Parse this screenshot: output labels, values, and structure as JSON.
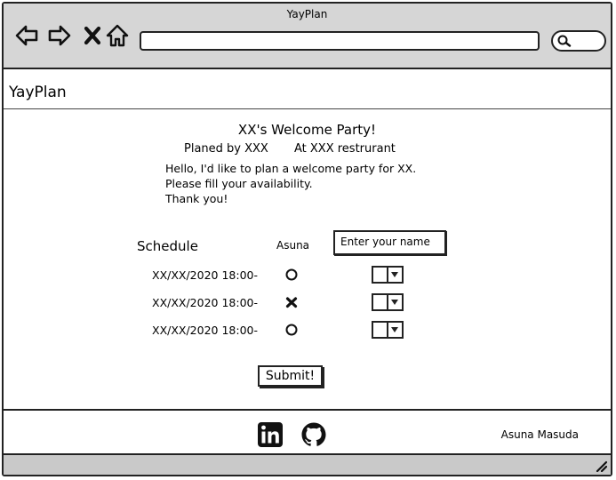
{
  "browser": {
    "title": "YayPlan",
    "nav_icons": [
      "back-arrow-icon",
      "forward-arrow-icon",
      "close-icon",
      "home-icon"
    ],
    "url": "",
    "search_icon": "search-icon"
  },
  "app": {
    "name": "YayPlan"
  },
  "event": {
    "title": "XX's Welcome Party!",
    "planner": "Planed by XXX",
    "location": "At XXX restrurant",
    "message": [
      "Hello, I'd like to plan a welcome party for XX.",
      "Please fill your availability.",
      "Thank you!"
    ]
  },
  "schedule": {
    "label": "Schedule",
    "participant": "Asuna",
    "name_placeholder": "Enter your name",
    "rows": [
      {
        "date": "XX/XX/2020 18:00-",
        "mark": "circle"
      },
      {
        "date": "XX/XX/2020 18:00-",
        "mark": "cross"
      },
      {
        "date": "XX/XX/2020 18:00-",
        "mark": "circle"
      }
    ]
  },
  "submit_label": "Submit!",
  "footer": {
    "icons": [
      "linkedin-icon",
      "github-icon"
    ],
    "author": "Asuna Masuda"
  }
}
